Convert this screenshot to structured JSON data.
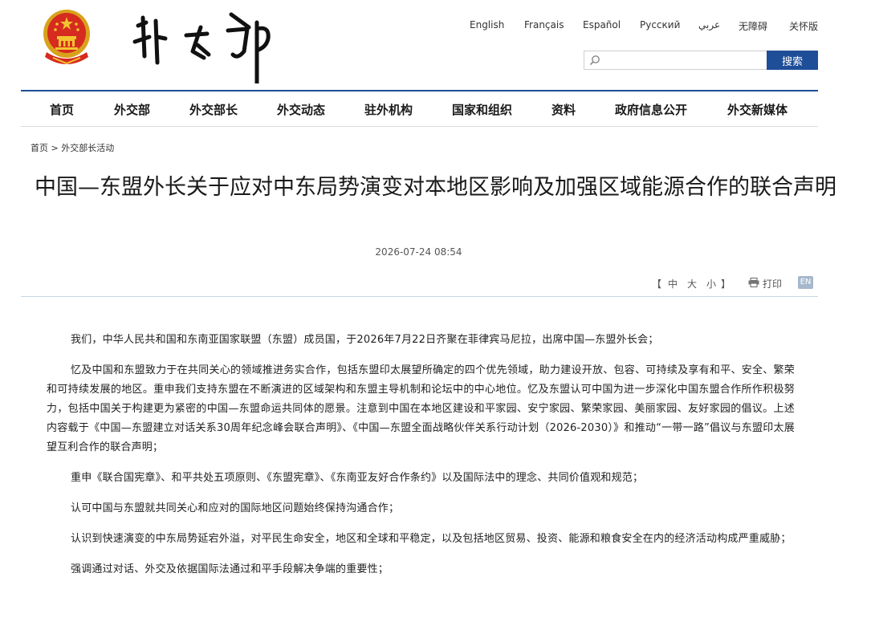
{
  "header": {
    "languages": [
      "English",
      "Français",
      "Español",
      "Русский",
      "عربي",
      "无障碍",
      "关怀版"
    ],
    "search": {
      "placeholder": "",
      "button_label": "搜索"
    },
    "brand_color": "#1f4e98"
  },
  "nav": {
    "items": [
      "首页",
      "外交部",
      "外交部长",
      "外交动态",
      "驻外机构",
      "国家和组织",
      "资料",
      "政府信息公开",
      "外交新媒体"
    ]
  },
  "breadcrumb": {
    "home": "首页",
    "separator": ">",
    "current": "外交部长活动"
  },
  "article": {
    "title": "中国—东盟外长关于应对中东局势演变对本地区影响及加强区域能源合作的联合声明",
    "date": "2026-07-24 08:54",
    "font_size_label_open": "【",
    "font_size_small": "中",
    "font_size_large": "大",
    "font_size_xsmall": "小",
    "font_size_label_close": "】",
    "print_label": "打印",
    "en_label": "EN",
    "paragraphs": [
      "我们，中华人民共和国和东南亚国家联盟（东盟）成员国，于2026年7月22日齐聚在菲律宾马尼拉，出席中国—东盟外长会；",
      "忆及中国和东盟致力于在共同关心的领域推进务实合作，包括东盟印太展望所确定的四个优先领域，助力建设开放、包容、可持续及享有和平、安全、繁荣和可持续发展的地区。重申我们支持东盟在不断演进的区域架构和东盟主导机制和论坛中的中心地位。忆及东盟认可中国为进一步深化中国东盟合作所作积极努力，包括中国关于构建更为紧密的中国—东盟命运共同体的愿景。注意到中国在本地区建设和平家园、安宁家园、繁荣家园、美丽家园、友好家园的倡议。上述内容载于《中国—东盟建立对话关系30周年纪念峰会联合声明》、《中国—东盟全面战略伙伴关系行动计划（2026-2030）》和推动“一带一路”倡议与东盟印太展望互利合作的联合声明；",
      "重申《联合国宪章》、和平共处五项原则、《东盟宪章》、《东南亚友好合作条约》以及国际法中的理念、共同价值观和规范；",
      "认可中国与东盟就共同关心和应对的国际地区问题始终保持沟通合作；",
      "认识到快速演变的中东局势延宕外溢，对平民生命安全，地区和全球和平稳定，以及包括地区贸易、投资、能源和粮食安全在内的经济活动构成严重威胁；",
      "强调通过对话、外交及依据国际法通过和平手段解决争端的重要性；"
    ]
  }
}
